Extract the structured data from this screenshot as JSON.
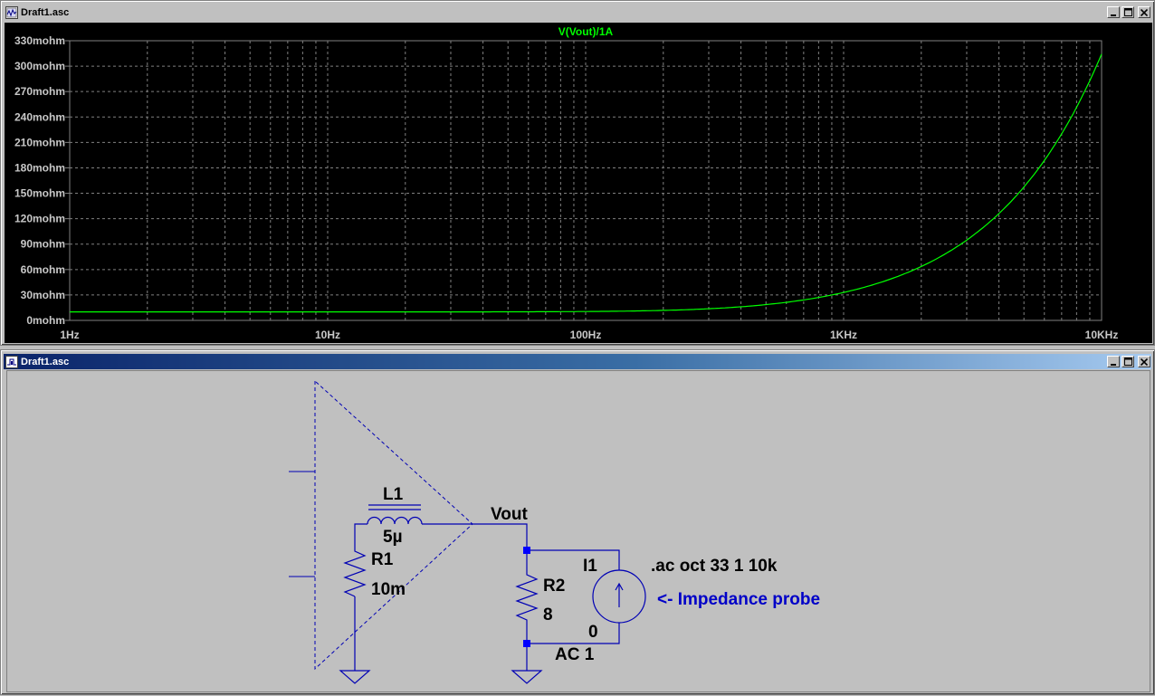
{
  "plot_window": {
    "title": "Draft1.asc",
    "buttons": {
      "minimize": "minimize",
      "restore": "restore",
      "close": "close"
    }
  },
  "schematic_window": {
    "title": "Draft1.asc",
    "buttons": {
      "minimize": "minimize",
      "restore": "restore",
      "close": "close"
    }
  },
  "colors": {
    "trace": "#00ff00",
    "grid": "#808080",
    "plot_bg": "#000000",
    "schematic_bg": "#c0c0c0",
    "wire": "#0000b4",
    "junction": "#0000ff",
    "comment": "#0000c8",
    "active_title": "#0a246a"
  },
  "chart_data": {
    "type": "line",
    "title": "V(Vout)/1A",
    "xlabel": "",
    "ylabel": "",
    "xscale": "log",
    "xlim": [
      1,
      10000
    ],
    "ylim": [
      0,
      330
    ],
    "grid": true,
    "x_ticks": [
      {
        "value": 1,
        "label": "1Hz"
      },
      {
        "value": 10,
        "label": "10Hz"
      },
      {
        "value": 100,
        "label": "100Hz"
      },
      {
        "value": 1000,
        "label": "1KHz"
      },
      {
        "value": 10000,
        "label": "10KHz"
      }
    ],
    "y_ticks": [
      {
        "value": 0,
        "label": "0mohm"
      },
      {
        "value": 30,
        "label": "30mohm"
      },
      {
        "value": 60,
        "label": "60mohm"
      },
      {
        "value": 90,
        "label": "90mohm"
      },
      {
        "value": 120,
        "label": "120mohm"
      },
      {
        "value": 150,
        "label": "150mohm"
      },
      {
        "value": 180,
        "label": "180mohm"
      },
      {
        "value": 210,
        "label": "210mohm"
      },
      {
        "value": 240,
        "label": "240mohm"
      },
      {
        "value": 270,
        "label": "270mohm"
      },
      {
        "value": 300,
        "label": "300mohm"
      },
      {
        "value": 330,
        "label": "330mohm"
      }
    ],
    "series": [
      {
        "name": "V(Vout)/1A",
        "color": "#00ff00",
        "model": {
          "R_mohm": 10,
          "L_uH": 5
        }
      }
    ]
  },
  "schematic": {
    "labels": {
      "l1_name": "L1",
      "l1_value": "5µ",
      "r1_name": "R1",
      "r1_value": "10m",
      "net_vout": "Vout",
      "r2_name": "R2",
      "r2_value": "8",
      "i1_name": "I1",
      "i1_dc": "0",
      "i1_ac": "AC 1",
      "directive": ".ac oct 33 1 10k",
      "comment": "<- Impedance probe"
    }
  }
}
